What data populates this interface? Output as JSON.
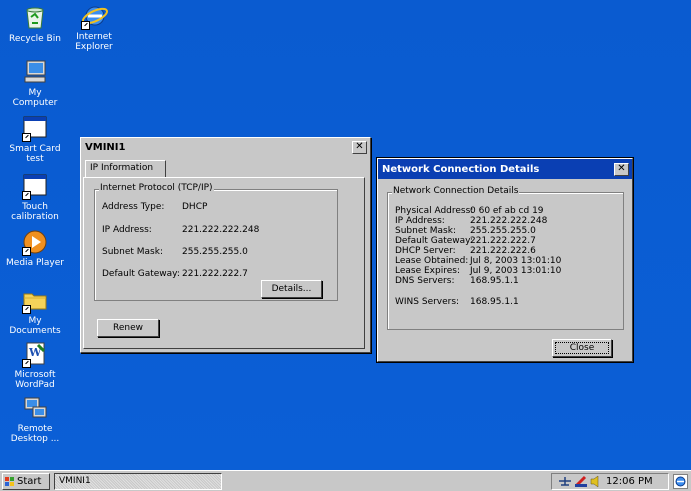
{
  "desktop_icons": [
    {
      "name": "recycle-bin",
      "label": "Recycle Bin"
    },
    {
      "name": "internet-explorer",
      "label_lines": [
        "Internet",
        "Explorer"
      ]
    },
    {
      "name": "my-computer",
      "label_lines": [
        "My",
        "Computer"
      ]
    },
    {
      "name": "smart-card-test",
      "label_lines": [
        "Smart Card",
        "test"
      ]
    },
    {
      "name": "touch-calibration",
      "label_lines": [
        "Touch",
        "calibration"
      ]
    },
    {
      "name": "media-player",
      "label": "Media Player"
    },
    {
      "name": "my-documents",
      "label_lines": [
        "My",
        "Documents"
      ]
    },
    {
      "name": "microsoft-wordpad",
      "label_lines": [
        "Microsoft",
        "WordPad"
      ]
    },
    {
      "name": "remote-desktop",
      "label_lines": [
        "Remote",
        "Desktop ..."
      ]
    }
  ],
  "vmini_window": {
    "title": "VMINI1",
    "tab": "IP Information",
    "group_title": "Internet Protocol (TCP/IP)",
    "fields": [
      {
        "label": "Address Type:",
        "value": "DHCP"
      },
      {
        "label": "IP Address:",
        "value": "221.222.222.248"
      },
      {
        "label": "Subnet Mask:",
        "value": "255.255.255.0"
      },
      {
        "label": "Default Gateway:",
        "value": "221.222.222.7"
      }
    ],
    "details_button": "Details...",
    "renew_button": "Renew"
  },
  "details_window": {
    "title": "Network Connection Details",
    "group_title": "Network Connection Details",
    "fields": [
      {
        "label": "Physical Address:",
        "value": "0 60 ef ab cd 19"
      },
      {
        "label": "IP Address:",
        "value": "221.222.222.248"
      },
      {
        "label": "Subnet Mask:",
        "value": "255.255.255.0"
      },
      {
        "label": "Default Gateway:",
        "value": "221.222.222.7"
      },
      {
        "label": "DHCP Server:",
        "value": "221.222.222.6"
      },
      {
        "label": "Lease Obtained:",
        "value": "Jul 8, 2003 13:01:10"
      },
      {
        "label": "Lease Expires:",
        "value": "Jul 9, 2003 13:01:10"
      },
      {
        "label": "DNS Servers:",
        "value": "168.95.1.1"
      },
      {
        "label": "WINS Servers:",
        "value": "168.95.1.1"
      }
    ],
    "close_button": "Close"
  },
  "taskbar": {
    "start_label": "Start",
    "task_label": "VMINI1",
    "clock": "12:06 PM"
  },
  "colors": {
    "desktop": "#0b5ccf",
    "active_title": "#0a3fb3"
  }
}
